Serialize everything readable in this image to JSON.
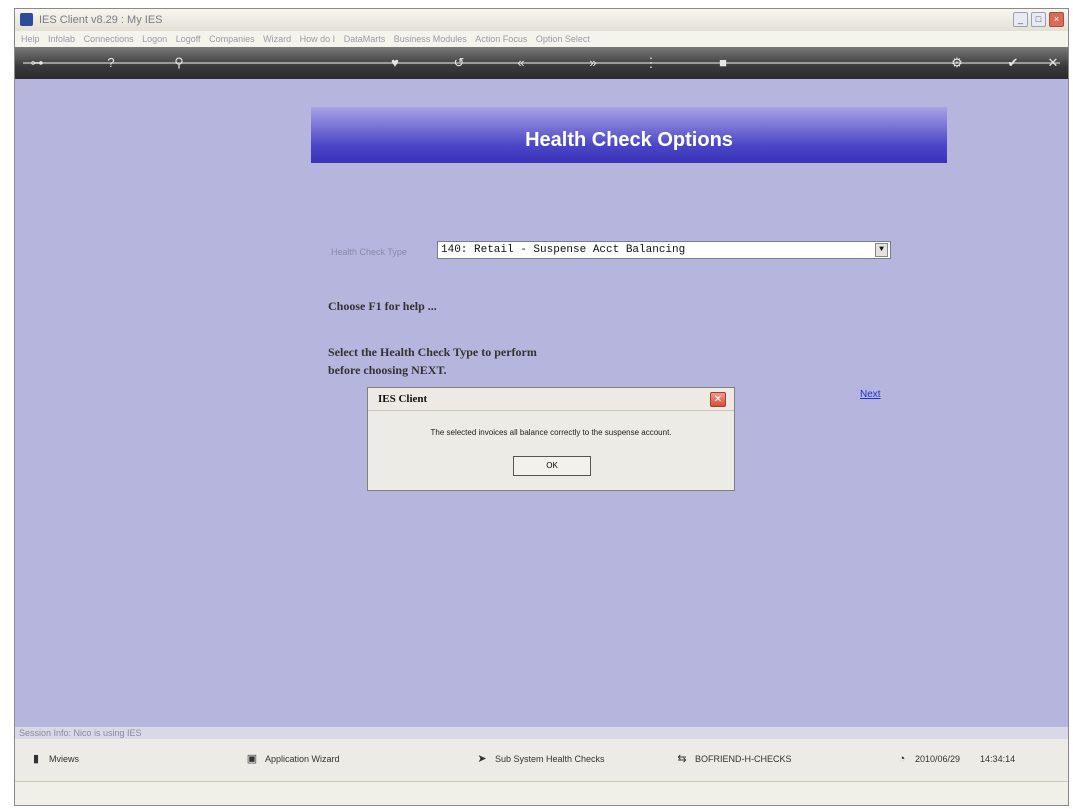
{
  "window": {
    "title": "IES Client v8.29 : My IES"
  },
  "menubar": {
    "items": [
      "Help",
      "Infolab",
      "Connections",
      "Logon",
      "Logoff",
      "Companies",
      "Wizard",
      "How do I",
      "DataMarts",
      "Business Modules",
      "Action Focus",
      "Option Select"
    ]
  },
  "toolbar": {
    "icons": [
      "key-icon",
      "help-icon",
      "search-icon",
      "heart-icon",
      "undo-icon",
      "back-icon",
      "forward-icon",
      "menu-icon",
      "stop-icon",
      "settings-icon",
      "ok-icon",
      "close-icon"
    ]
  },
  "page": {
    "header": "Health Check Options",
    "health_check_label": "Health Check Type",
    "health_check_value": "140: Retail - Suspense Acct Balancing",
    "help_text": "Choose F1 for help ...",
    "instruction_line1": "Select the Health Check Type to perform",
    "instruction_line2": "before choosing NEXT.",
    "next_label": "Next"
  },
  "dialog": {
    "title": "IES Client",
    "message": "The selected invoices all balance correctly to the suspense account.",
    "ok_label": "OK"
  },
  "session": {
    "text": "Session Info: Nico is using IES"
  },
  "statusbar": {
    "mviews": "Mviews",
    "app_wizard": "Application Wizard",
    "subsystem": "Sub System Health Checks",
    "bofriend": "BOFRIEND-H-CHECKS",
    "date": "2010/06/29",
    "time": "14:34:14"
  }
}
